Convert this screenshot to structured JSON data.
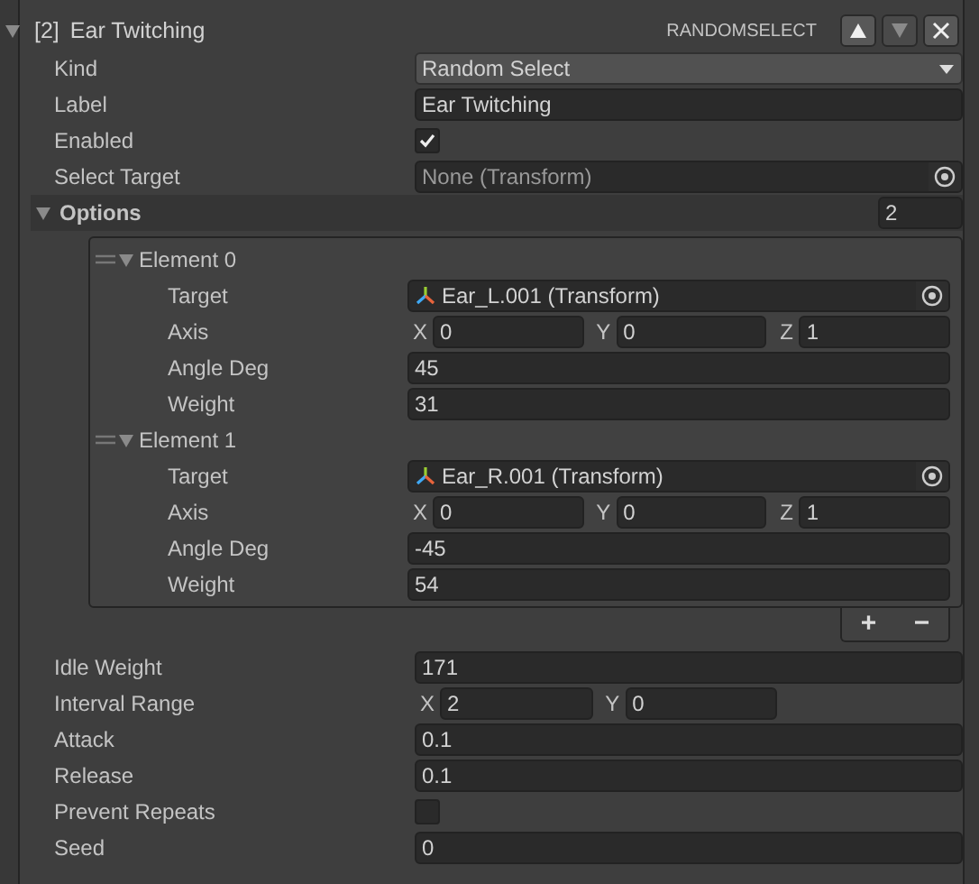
{
  "component": {
    "index": "[2]",
    "title": "Ear Twitching",
    "expanded": true,
    "type_label": "RANDOMSELECT",
    "buttons": [
      {
        "kind": "up",
        "disabled": false
      },
      {
        "kind": "down",
        "disabled": true
      },
      {
        "kind": "close",
        "disabled": false
      }
    ]
  },
  "fields": [
    {
      "kind": "dropdown",
      "label": "Kind",
      "value": "Random Select"
    },
    {
      "kind": "text",
      "label": "Label",
      "value": "Ear Twitching"
    },
    {
      "kind": "checkbox",
      "label": "Enabled",
      "checked": true
    },
    {
      "kind": "object",
      "label": "Select Target",
      "value": "None (Transform)",
      "assigned": false
    }
  ],
  "options": {
    "label": "Options",
    "expanded": true,
    "count": "2",
    "elements": [
      {
        "label": "Element 0",
        "expanded": true,
        "fields": [
          {
            "kind": "object",
            "label": "Target",
            "value": "Ear_L.001 (Transform)",
            "assigned": true
          },
          {
            "kind": "vector",
            "label": "Axis",
            "components": [
              {
                "axis": "X",
                "value": "0"
              },
              {
                "axis": "Y",
                "value": "0"
              },
              {
                "axis": "Z",
                "value": "1"
              }
            ]
          },
          {
            "kind": "text",
            "label": "Angle Deg",
            "value": "45"
          },
          {
            "kind": "text",
            "label": "Weight",
            "value": "31"
          }
        ]
      },
      {
        "label": "Element 1",
        "expanded": true,
        "fields": [
          {
            "kind": "object",
            "label": "Target",
            "value": "Ear_R.001 (Transform)",
            "assigned": true
          },
          {
            "kind": "vector",
            "label": "Axis",
            "components": [
              {
                "axis": "X",
                "value": "0"
              },
              {
                "axis": "Y",
                "value": "0"
              },
              {
                "axis": "Z",
                "value": "1"
              }
            ]
          },
          {
            "kind": "text",
            "label": "Angle Deg",
            "value": "-45"
          },
          {
            "kind": "text",
            "label": "Weight",
            "value": "54"
          }
        ]
      }
    ],
    "footer_buttons": [
      "+",
      "−"
    ]
  },
  "settings": [
    {
      "kind": "text",
      "label": "Idle Weight",
      "value": "171"
    },
    {
      "kind": "vector",
      "label": "Interval Range",
      "components": [
        {
          "axis": "X",
          "value": "2"
        },
        {
          "axis": "Y",
          "value": "0"
        }
      ]
    },
    {
      "kind": "text",
      "label": "Attack",
      "value": "0.1"
    },
    {
      "kind": "text",
      "label": "Release",
      "value": "0.1"
    },
    {
      "kind": "checkbox",
      "label": "Prevent Repeats",
      "checked": false
    },
    {
      "kind": "text",
      "label": "Seed",
      "value": "0"
    }
  ]
}
